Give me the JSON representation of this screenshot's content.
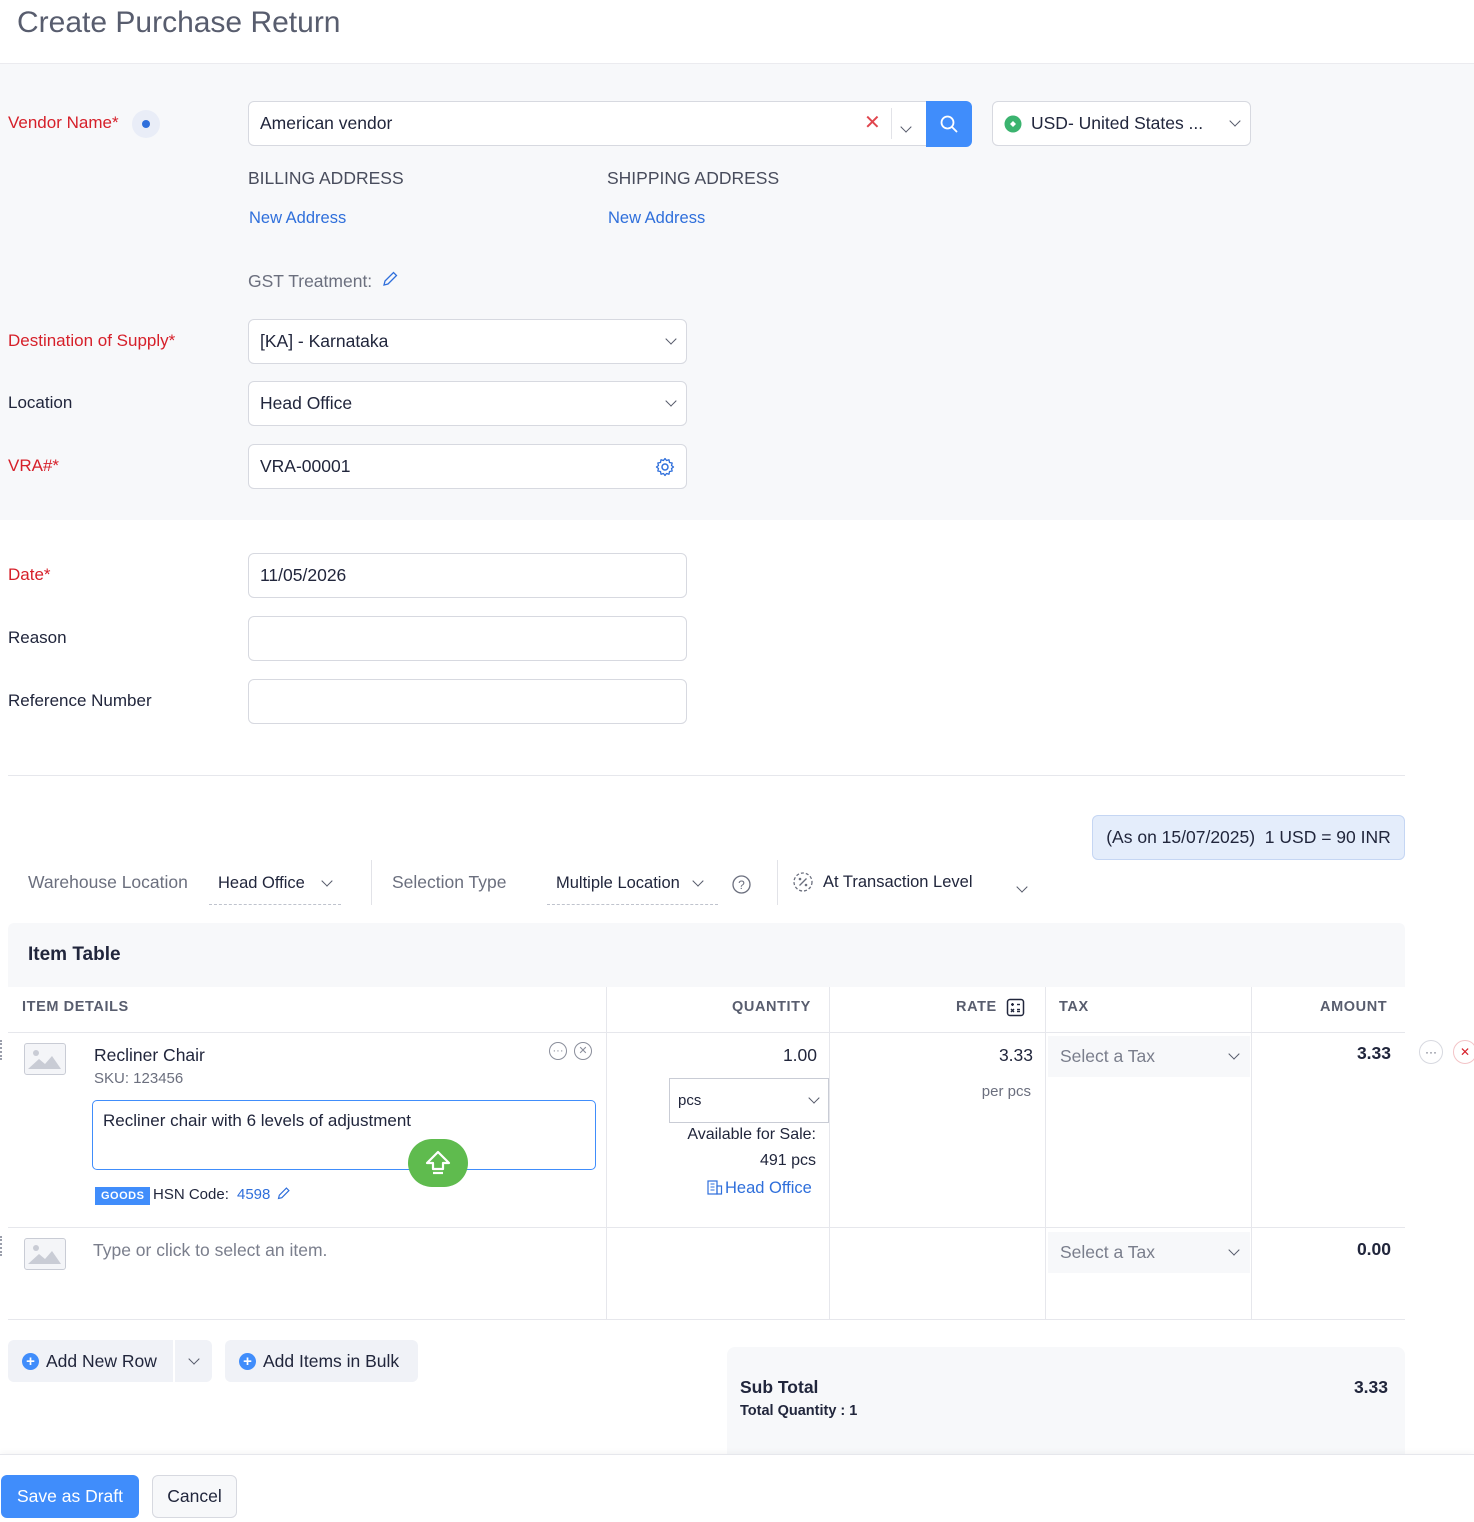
{
  "page": {
    "title": "Create Purchase Return"
  },
  "vendor": {
    "label": "Vendor Name*",
    "value": "American vendor",
    "currency": "USD- United States ..."
  },
  "addresses": {
    "billing_heading": "BILLING ADDRESS",
    "shipping_heading": "SHIPPING ADDRESS",
    "billing_link": "New Address",
    "shipping_link": "New Address"
  },
  "gst": {
    "label": "GST Treatment:"
  },
  "form": {
    "destination_label": "Destination of Supply*",
    "destination_value": "[KA] - Karnataka",
    "location_label": "Location",
    "location_value": "Head Office",
    "vra_label": "VRA#*",
    "vra_value": "VRA-00001",
    "date_label": "Date*",
    "date_value": "11/05/2026",
    "reason_label": "Reason",
    "reason_value": "",
    "reference_label": "Reference Number",
    "reference_value": ""
  },
  "exchange": {
    "text": "(As on 15/07/2025)  1 USD = 90 INR"
  },
  "toolbar": {
    "warehouse_label": "Warehouse Location",
    "warehouse_value": "Head Office",
    "selection_label": "Selection Type",
    "selection_value": "Multiple Location",
    "discount_value": "At Transaction Level"
  },
  "item_table": {
    "title": "Item Table",
    "headers": {
      "details": "ITEM DETAILS",
      "quantity": "QUANTITY",
      "rate": "RATE",
      "tax": "TAX",
      "amount": "AMOUNT"
    },
    "row1": {
      "name": "Recliner Chair",
      "sku": "SKU: 123456",
      "description": "Recliner chair with 6 levels of adjustment",
      "type_badge": "GOODS",
      "hsn_label": "HSN Code:",
      "hsn_value": "4598",
      "quantity": "1.00",
      "unit": "pcs",
      "available_label": "Available for Sale:",
      "available_value": "491 pcs",
      "location_link": "Head Office",
      "rate": "3.33",
      "rate_unit": "per pcs",
      "tax_placeholder": "Select a Tax",
      "amount": "3.33"
    },
    "row2": {
      "placeholder": "Type or click to select an item.",
      "tax_placeholder": "Select a Tax",
      "amount": "0.00"
    }
  },
  "actions": {
    "add_row": "Add New Row",
    "add_bulk": "Add Items in Bulk",
    "save_draft": "Save as Draft",
    "cancel": "Cancel"
  },
  "totals": {
    "subtotal_label": "Sub Total",
    "subtotal_value": "3.33",
    "total_qty": "Total Quantity : 1"
  },
  "colors": {
    "accent": "#408dfb",
    "required": "#d6202a",
    "link": "#2f6fdb",
    "upload": "#5fbb4e"
  }
}
